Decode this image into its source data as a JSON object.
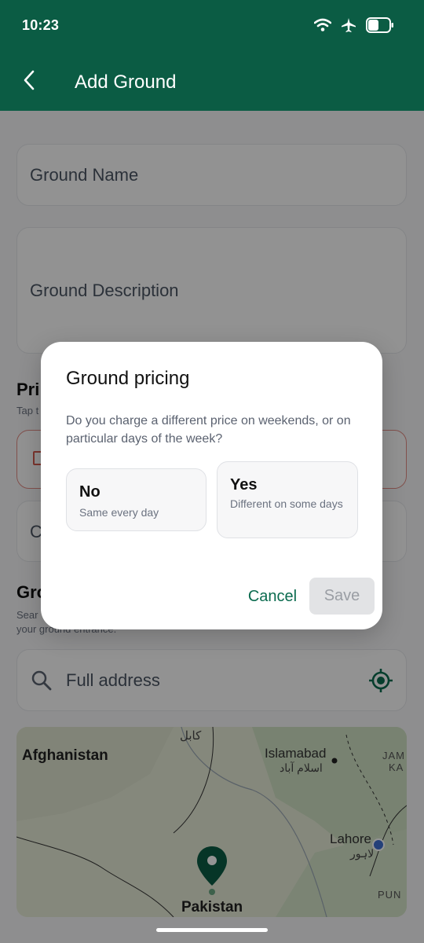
{
  "status_bar": {
    "time": "10:23",
    "icons": [
      "wifi-icon",
      "airplane-icon",
      "battery-icon"
    ]
  },
  "app_bar": {
    "title": "Add Ground",
    "back_icon": "chevron-left-icon"
  },
  "form": {
    "ground_name_placeholder": "Ground Name",
    "ground_description_placeholder": "Ground Description",
    "pricing_title_partial": "Pri",
    "pricing_sub_partial": "Tap t",
    "category_partial": "C",
    "location_title_partial": "Gro",
    "location_sub_line1_partial": "Sear",
    "location_sub_line2": "your ground entrance.",
    "address_placeholder": "Full address"
  },
  "map": {
    "labels": [
      "Afghanistan",
      "کابل",
      "Islamabad",
      "اسلام آباد",
      "JAM",
      "KA",
      "Lahore",
      "لاہور",
      "PUN",
      "Pakistan"
    ]
  },
  "dialog": {
    "title": "Ground pricing",
    "text": "Do you charge a different price on weekends, or on particular days of the week?",
    "options": [
      {
        "title": "No",
        "subtitle": "Same every day"
      },
      {
        "title": "Yes",
        "subtitle": "Different on some days"
      }
    ],
    "cancel_label": "Cancel",
    "save_label": "Save"
  },
  "colors": {
    "brand": "#0b5c44",
    "accent_text": "#0b6b4f"
  }
}
